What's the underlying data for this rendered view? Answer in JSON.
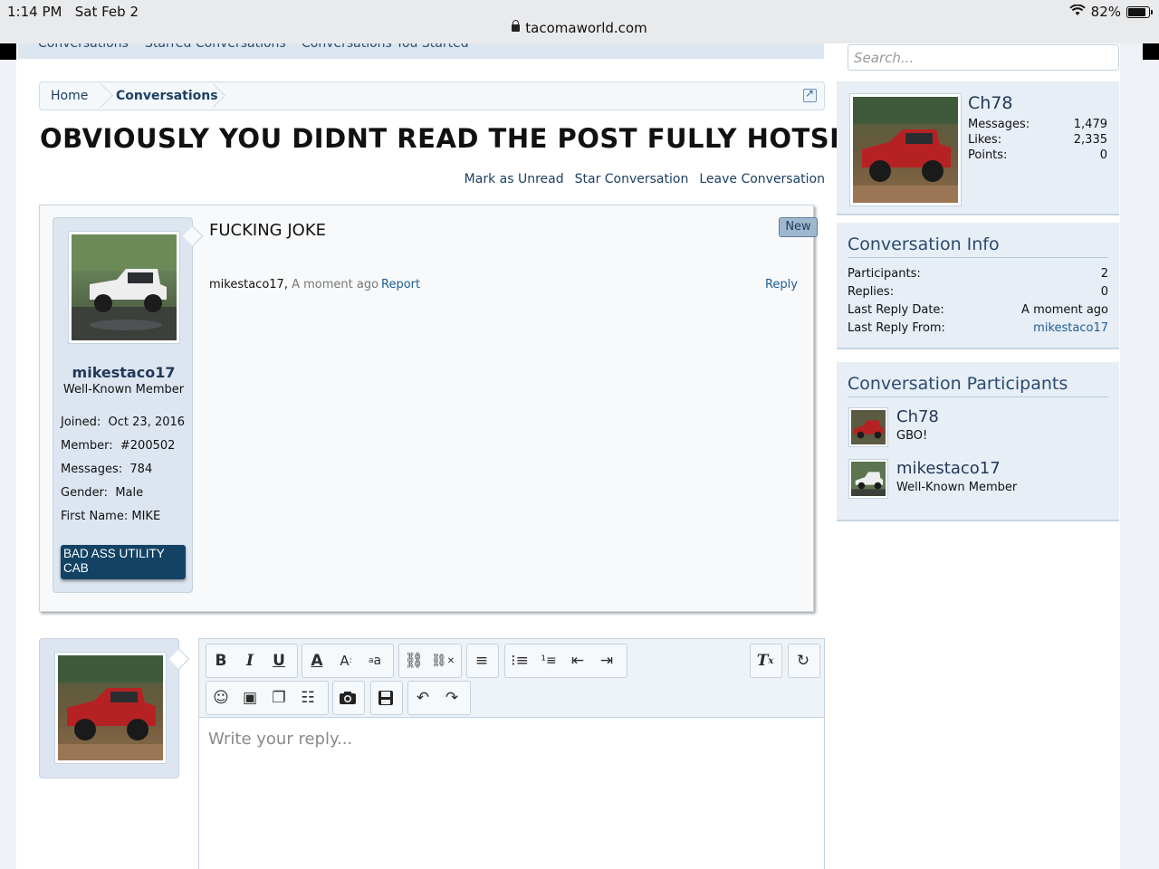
{
  "status_bar": {
    "time": "1:14 PM",
    "date": "Sat Feb 2",
    "battery": "82%",
    "url": "tacomaworld.com"
  },
  "nav_tabs": [
    "Conversations",
    "Starred Conversations",
    "Conversations You Started"
  ],
  "breadcrumb": {
    "home": "Home",
    "current": "Conversations"
  },
  "title": "OBVIOUSLY YOU DIDNT READ THE POST FULLY HOTSHOT",
  "actions": {
    "mark_unread": "Mark as Unread",
    "star": "Star Conversation",
    "leave": "Leave Conversation"
  },
  "message": {
    "body": "FUCKING JOKE",
    "badge": "New",
    "author": "mikestaco17",
    "time": "A moment ago",
    "report": "Report",
    "reply": "Reply",
    "user": {
      "name": "mikestaco17",
      "title": "Well-Known Member",
      "joined_label": "Joined:",
      "joined": "Oct 23, 2016",
      "member_label": "Member:",
      "member": "#200502",
      "messages_label": "Messages:",
      "messages": "784",
      "gender_label": "Gender:",
      "gender": "Male",
      "first_name_label": "First Name:",
      "first_name": "MIKE",
      "banner": "BAD ASS UTILITY CAB"
    }
  },
  "editor": {
    "placeholder": "Write your reply..."
  },
  "sidebar": {
    "search_placeholder": "Search...",
    "visitor": {
      "name": "Ch78",
      "messages_label": "Messages:",
      "messages": "1,479",
      "likes_label": "Likes:",
      "likes": "2,335",
      "points_label": "Points:",
      "points": "0"
    },
    "info": {
      "heading": "Conversation Info",
      "participants_label": "Participants:",
      "participants": "2",
      "replies_label": "Replies:",
      "replies": "0",
      "last_date_label": "Last Reply Date:",
      "last_date": "A moment ago",
      "last_from_label": "Last Reply From:",
      "last_from": "mikestaco17"
    },
    "participants": {
      "heading": "Conversation Participants",
      "list": [
        {
          "name": "Ch78",
          "title": "GBO!"
        },
        {
          "name": "mikestaco17",
          "title": "Well-Known Member"
        }
      ]
    }
  },
  "colors": {
    "link": "#1e5d95",
    "heading": "#2b4a6e",
    "banner": "#134264"
  }
}
